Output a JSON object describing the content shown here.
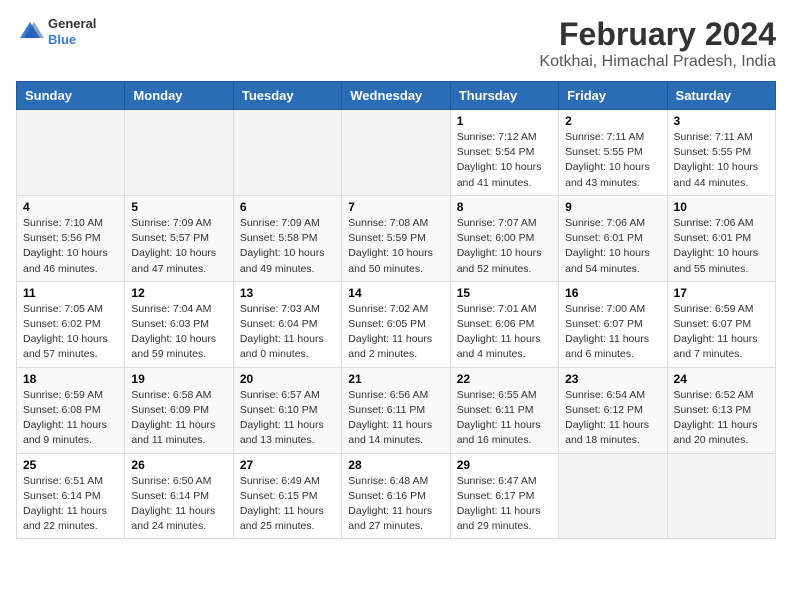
{
  "logo": {
    "general": "General",
    "blue": "Blue"
  },
  "title": "February 2024",
  "subtitle": "Kotkhai, Himachal Pradesh, India",
  "weekdays": [
    "Sunday",
    "Monday",
    "Tuesday",
    "Wednesday",
    "Thursday",
    "Friday",
    "Saturday"
  ],
  "weeks": [
    [
      {
        "day": "",
        "info": ""
      },
      {
        "day": "",
        "info": ""
      },
      {
        "day": "",
        "info": ""
      },
      {
        "day": "",
        "info": ""
      },
      {
        "day": "1",
        "info": "Sunrise: 7:12 AM\nSunset: 5:54 PM\nDaylight: 10 hours\nand 41 minutes."
      },
      {
        "day": "2",
        "info": "Sunrise: 7:11 AM\nSunset: 5:55 PM\nDaylight: 10 hours\nand 43 minutes."
      },
      {
        "day": "3",
        "info": "Sunrise: 7:11 AM\nSunset: 5:55 PM\nDaylight: 10 hours\nand 44 minutes."
      }
    ],
    [
      {
        "day": "4",
        "info": "Sunrise: 7:10 AM\nSunset: 5:56 PM\nDaylight: 10 hours\nand 46 minutes."
      },
      {
        "day": "5",
        "info": "Sunrise: 7:09 AM\nSunset: 5:57 PM\nDaylight: 10 hours\nand 47 minutes."
      },
      {
        "day": "6",
        "info": "Sunrise: 7:09 AM\nSunset: 5:58 PM\nDaylight: 10 hours\nand 49 minutes."
      },
      {
        "day": "7",
        "info": "Sunrise: 7:08 AM\nSunset: 5:59 PM\nDaylight: 10 hours\nand 50 minutes."
      },
      {
        "day": "8",
        "info": "Sunrise: 7:07 AM\nSunset: 6:00 PM\nDaylight: 10 hours\nand 52 minutes."
      },
      {
        "day": "9",
        "info": "Sunrise: 7:06 AM\nSunset: 6:01 PM\nDaylight: 10 hours\nand 54 minutes."
      },
      {
        "day": "10",
        "info": "Sunrise: 7:06 AM\nSunset: 6:01 PM\nDaylight: 10 hours\nand 55 minutes."
      }
    ],
    [
      {
        "day": "11",
        "info": "Sunrise: 7:05 AM\nSunset: 6:02 PM\nDaylight: 10 hours\nand 57 minutes."
      },
      {
        "day": "12",
        "info": "Sunrise: 7:04 AM\nSunset: 6:03 PM\nDaylight: 10 hours\nand 59 minutes."
      },
      {
        "day": "13",
        "info": "Sunrise: 7:03 AM\nSunset: 6:04 PM\nDaylight: 11 hours\nand 0 minutes."
      },
      {
        "day": "14",
        "info": "Sunrise: 7:02 AM\nSunset: 6:05 PM\nDaylight: 11 hours\nand 2 minutes."
      },
      {
        "day": "15",
        "info": "Sunrise: 7:01 AM\nSunset: 6:06 PM\nDaylight: 11 hours\nand 4 minutes."
      },
      {
        "day": "16",
        "info": "Sunrise: 7:00 AM\nSunset: 6:07 PM\nDaylight: 11 hours\nand 6 minutes."
      },
      {
        "day": "17",
        "info": "Sunrise: 6:59 AM\nSunset: 6:07 PM\nDaylight: 11 hours\nand 7 minutes."
      }
    ],
    [
      {
        "day": "18",
        "info": "Sunrise: 6:59 AM\nSunset: 6:08 PM\nDaylight: 11 hours\nand 9 minutes."
      },
      {
        "day": "19",
        "info": "Sunrise: 6:58 AM\nSunset: 6:09 PM\nDaylight: 11 hours\nand 11 minutes."
      },
      {
        "day": "20",
        "info": "Sunrise: 6:57 AM\nSunset: 6:10 PM\nDaylight: 11 hours\nand 13 minutes."
      },
      {
        "day": "21",
        "info": "Sunrise: 6:56 AM\nSunset: 6:11 PM\nDaylight: 11 hours\nand 14 minutes."
      },
      {
        "day": "22",
        "info": "Sunrise: 6:55 AM\nSunset: 6:11 PM\nDaylight: 11 hours\nand 16 minutes."
      },
      {
        "day": "23",
        "info": "Sunrise: 6:54 AM\nSunset: 6:12 PM\nDaylight: 11 hours\nand 18 minutes."
      },
      {
        "day": "24",
        "info": "Sunrise: 6:52 AM\nSunset: 6:13 PM\nDaylight: 11 hours\nand 20 minutes."
      }
    ],
    [
      {
        "day": "25",
        "info": "Sunrise: 6:51 AM\nSunset: 6:14 PM\nDaylight: 11 hours\nand 22 minutes."
      },
      {
        "day": "26",
        "info": "Sunrise: 6:50 AM\nSunset: 6:14 PM\nDaylight: 11 hours\nand 24 minutes."
      },
      {
        "day": "27",
        "info": "Sunrise: 6:49 AM\nSunset: 6:15 PM\nDaylight: 11 hours\nand 25 minutes."
      },
      {
        "day": "28",
        "info": "Sunrise: 6:48 AM\nSunset: 6:16 PM\nDaylight: 11 hours\nand 27 minutes."
      },
      {
        "day": "29",
        "info": "Sunrise: 6:47 AM\nSunset: 6:17 PM\nDaylight: 11 hours\nand 29 minutes."
      },
      {
        "day": "",
        "info": ""
      },
      {
        "day": "",
        "info": ""
      }
    ]
  ]
}
